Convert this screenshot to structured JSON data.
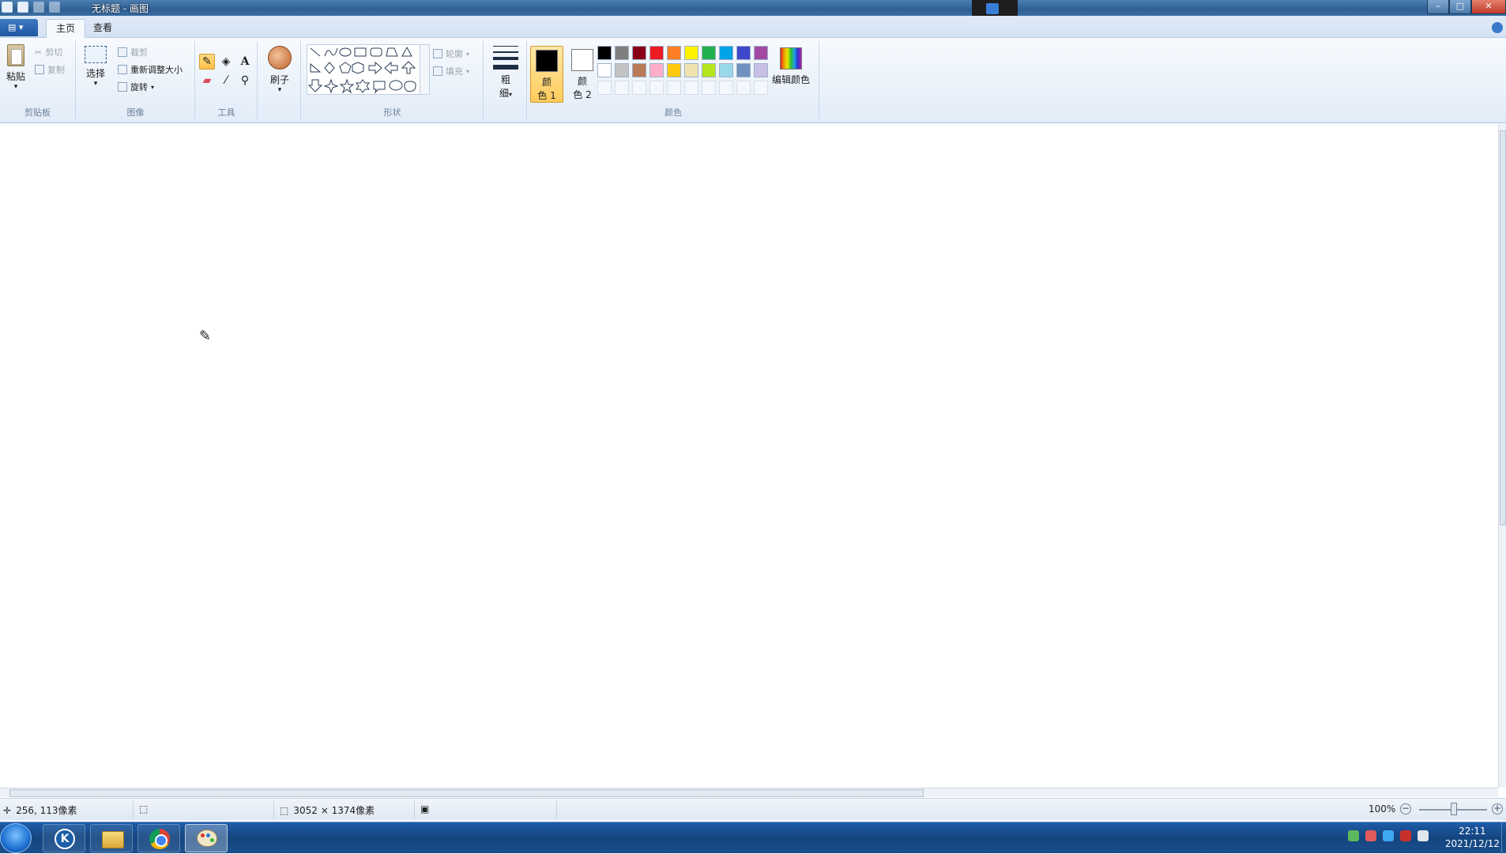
{
  "window": {
    "title": "无标题 - 画图",
    "controls": [
      "minimize",
      "maximize",
      "close"
    ]
  },
  "tabs": [
    {
      "label": "主页",
      "active": true
    },
    {
      "label": "查看",
      "active": false
    }
  ],
  "ribbon": {
    "clipboard": {
      "group_label": "剪贴板",
      "paste": "粘贴",
      "cut": "剪切",
      "copy": "复制"
    },
    "image": {
      "group_label": "图像",
      "select": "选择",
      "crop": "裁剪",
      "resize": "重新调整大小",
      "rotate": "旋转"
    },
    "tools": {
      "group_label": "工具",
      "items": [
        "pencil-icon",
        "fill-icon",
        "text-icon",
        "eraser-icon",
        "color-picker-icon",
        "magnifier-icon"
      ],
      "active": "pencil-icon"
    },
    "brushes": {
      "label": "刷子"
    },
    "shapes": {
      "group_label": "形状",
      "outline": "轮廓",
      "fill": "填充"
    },
    "size": {
      "label_line1": "粗",
      "label_line2": "细"
    },
    "colors": {
      "group_label": "颜色",
      "color1_l1": "颜",
      "color1_l2": "色 1",
      "color2_l1": "颜",
      "color2_l2": "色 2",
      "color1_value": "#000000",
      "color2_value": "#ffffff",
      "edit_colors": "编辑颜色",
      "palette_row1": [
        "#000000",
        "#7f7f7f",
        "#880015",
        "#ed1c24",
        "#ff7f27",
        "#fff200",
        "#22b14c",
        "#00a2e8",
        "#3f48cc",
        "#a349a4"
      ],
      "palette_row2": [
        "#ffffff",
        "#c3c3c3",
        "#b97a57",
        "#ffaec9",
        "#ffc90e",
        "#efe4b0",
        "#b5e61d",
        "#99d9ea",
        "#7092be",
        "#c8bfe7"
      ]
    }
  },
  "statusbar": {
    "cursor_pos": "256, 113像素",
    "image_size": "3052 × 1374像素",
    "zoom": "100%"
  },
  "taskbar": {
    "apps": [
      "k-app-icon",
      "file-explorer-icon",
      "chrome-icon",
      "paint-icon"
    ],
    "active_app": "paint-icon",
    "clock_time": "22:11",
    "clock_date": "2021/12/12"
  }
}
